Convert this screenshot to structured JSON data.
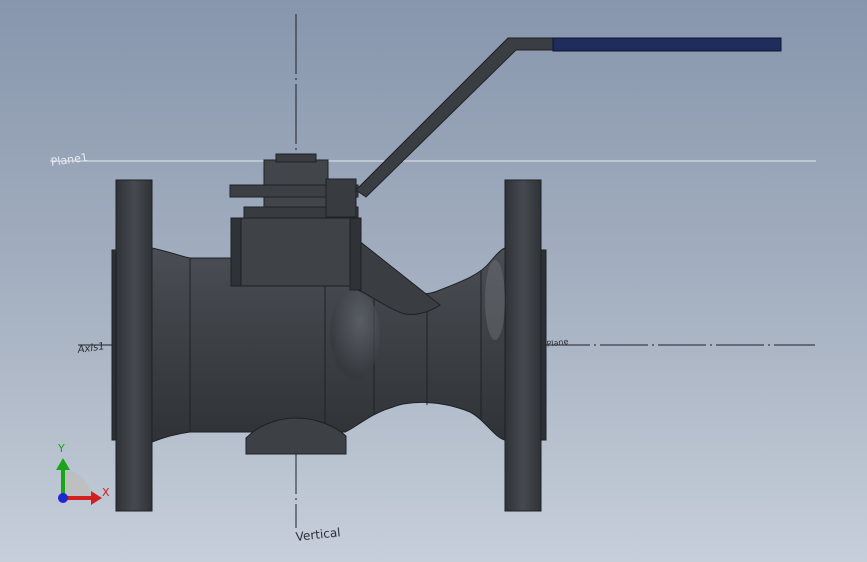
{
  "viewport": {
    "background_top": "#8796ad",
    "background_bottom": "#c6cfda"
  },
  "labels": {
    "plane1": "Plane1",
    "axis1": "Axis1",
    "plane2": "Plane",
    "vertical": "Vertical"
  },
  "triad": {
    "y_label": "Y",
    "x_label": "X",
    "y_color": "#1aa41a",
    "x_color": "#d02020",
    "z_color": "#1a2ad0"
  },
  "model": {
    "body_color": "#3b3f44",
    "handle_grip_color": "#1f2d5c"
  }
}
